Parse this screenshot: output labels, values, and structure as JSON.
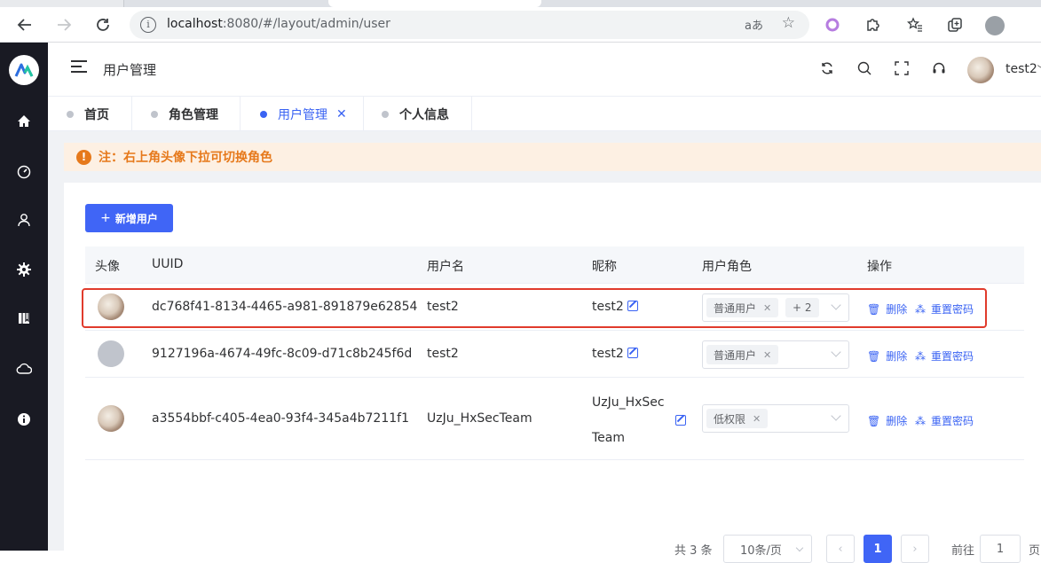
{
  "browser": {
    "url_host": "localhost",
    "url_path": ":8080/#/layout/admin/user",
    "read_aloud": "aあ",
    "icons": [
      "back-icon",
      "forward-icon",
      "reload-icon",
      "info-icon",
      "star-add-icon",
      "extension-circle-icon",
      "puzzle-icon",
      "favorites-icon",
      "collections-icon",
      "profile-icon"
    ]
  },
  "sidebar": {
    "items": [
      "home-icon",
      "dashboard-icon",
      "user-icon",
      "settings-icon",
      "book-icon",
      "cloud-icon",
      "info-icon"
    ]
  },
  "header": {
    "title": "用户管理",
    "username": "test2"
  },
  "tabs": [
    {
      "label": "首页",
      "active": false
    },
    {
      "label": "角色管理",
      "active": false
    },
    {
      "label": "用户管理",
      "active": true,
      "close": "✕"
    },
    {
      "label": "个人信息",
      "active": false
    }
  ],
  "notice": {
    "icon": "!",
    "text": "注：右上角头像下拉可切换角色"
  },
  "toolbar": {
    "add_user": "新增用户",
    "add_plus": "+"
  },
  "table": {
    "columns": [
      "头像",
      "UUID",
      "用户名",
      "昵称",
      "用户角色",
      "操作"
    ],
    "rows": [
      {
        "avatar": "photo",
        "uuid": "dc768f41-8134-4465-a981-891879e62854",
        "username": "test2",
        "nickname": "test2",
        "roles": [
          "普通用户"
        ],
        "roles_more": "+ 2",
        "delete": "删除",
        "reset": "重置密码",
        "highlighted": true
      },
      {
        "avatar": "gray",
        "uuid": "9127196a-4674-49fc-8c09-d71c8b245f6d",
        "username": "test2",
        "nickname": "test2",
        "roles": [
          "普通用户"
        ],
        "roles_more": "",
        "delete": "删除",
        "reset": "重置密码",
        "highlighted": false
      },
      {
        "avatar": "photo",
        "uuid": "a3554bbf-c405-4ea0-93f4-345a4b7211f1",
        "username": "UzJu_HxSecTeam",
        "nickname_line1": "UzJu_HxSec",
        "nickname_line2": "Team",
        "roles": [
          "低权限"
        ],
        "roles_more": "",
        "delete": "删除",
        "reset": "重置密码",
        "highlighted": false
      }
    ]
  },
  "pagination": {
    "total": "共 3 条",
    "page_size": "10条/页",
    "prev": "‹",
    "current": "1",
    "next": "›",
    "goto_label": "前往",
    "goto_value": "1",
    "goto_unit": "页"
  },
  "colors": {
    "primary": "#4065f6",
    "sidebar": "#191a23",
    "notice_bg": "#fdf0e3",
    "notice_text": "#e6791b",
    "highlight": "#e03b2c"
  }
}
